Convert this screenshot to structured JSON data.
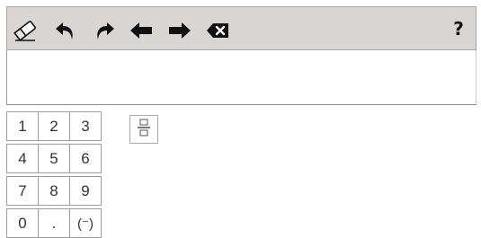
{
  "toolbar": {
    "buttons": [
      {
        "icon": "eraser-icon"
      },
      {
        "icon": "undo-icon"
      },
      {
        "icon": "redo-icon"
      },
      {
        "icon": "arrow-left-icon"
      },
      {
        "icon": "arrow-right-icon"
      },
      {
        "icon": "backspace-icon"
      }
    ],
    "help_label": "?"
  },
  "keypad": {
    "rows": [
      [
        "1",
        "2",
        "3"
      ],
      [
        "4",
        "5",
        "6"
      ],
      [
        "7",
        "8",
        "9"
      ],
      [
        "0",
        ".",
        "(⁻)"
      ]
    ]
  },
  "extra_keys": [
    {
      "icon": "fraction-template-icon"
    }
  ],
  "colors": {
    "toolbar_bg": "#d9d5d3",
    "toolbar_border": "#a7a4a2",
    "icon": "#111111",
    "key_border": "#9c9c9c"
  }
}
